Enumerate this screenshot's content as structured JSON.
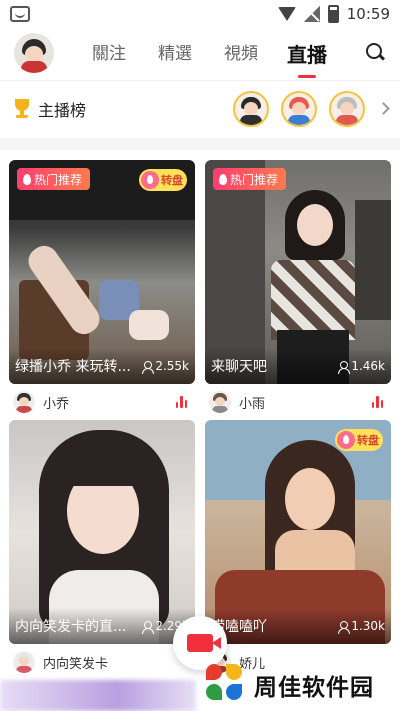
{
  "status_bar": {
    "time": "10:59"
  },
  "nav": {
    "tabs": [
      {
        "label": "關注"
      },
      {
        "label": "精選"
      },
      {
        "label": "視頻"
      },
      {
        "label": "直播"
      }
    ],
    "active_tab": "直播"
  },
  "ranking": {
    "title": "主播榜"
  },
  "cards": [
    {
      "tag": "热门推荐",
      "badge": "转盘",
      "title": "绿播小乔 来玩转...",
      "viewers": "2.55k",
      "user": "小乔"
    },
    {
      "tag": "热门推荐",
      "title": "来聊天吧",
      "viewers": "1.46k",
      "user": "小雨"
    },
    {
      "title": "内向笑发卡的直...",
      "viewers": "2.29k",
      "user": "内向笑发卡"
    },
    {
      "badge": "转盘",
      "title": "唠嗑嗑吖",
      "viewers": "1.30k",
      "user": "娇儿"
    }
  ],
  "watermark": {
    "text": "周佳软件园"
  },
  "colors": {
    "accent": "#f0313d",
    "hot_tag_start": "#ff3d71",
    "hot_tag_end": "#ff7a4d",
    "turntable_badge": "#ffe25a",
    "gold_ring": "#f5c33b"
  }
}
